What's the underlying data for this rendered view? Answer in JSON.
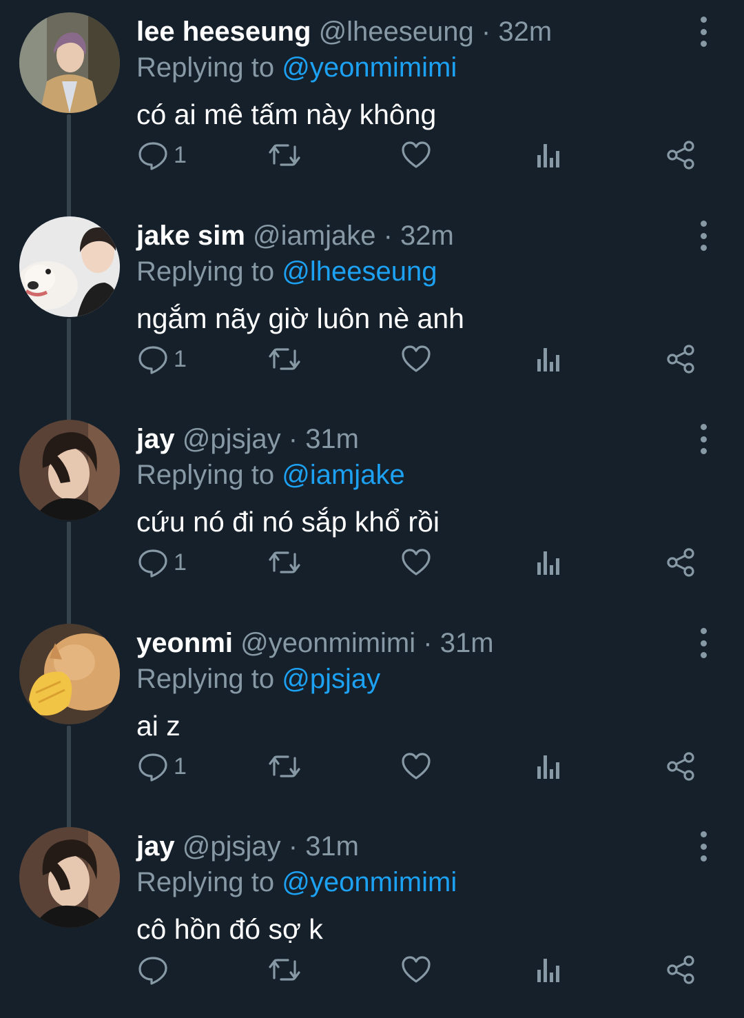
{
  "colors": {
    "background": "#15202b",
    "text": "#ffffff",
    "muted": "#8899a6",
    "mention": "#1da1f2",
    "thread_line": "#38444d"
  },
  "reply_prefix": "Replying to",
  "actions": [
    "reply-icon",
    "retweet-icon",
    "like-icon",
    "analytics-icon",
    "share-icon"
  ],
  "tweets": [
    {
      "name": "lee heeseung",
      "handle": "@lheeseung",
      "dot": "·",
      "time": "32m",
      "replying_to": "@yeonmimimi",
      "text": "có ai mê tấm này không",
      "reply_count": "1",
      "avatar": "avatar-lee-heeseung"
    },
    {
      "name": "jake sim",
      "handle": "@iamjake",
      "dot": "·",
      "time": "32m",
      "replying_to": "@lheeseung",
      "text": "ngắm nãy giờ luôn nè anh",
      "reply_count": "1",
      "avatar": "avatar-jake-sim"
    },
    {
      "name": "jay",
      "handle": "@pjsjay",
      "dot": "·",
      "time": "31m",
      "replying_to": "@iamjake",
      "text": "cứu nó đi nó sắp khổ rồi",
      "reply_count": "1",
      "avatar": "avatar-jay"
    },
    {
      "name": "yeonmi",
      "handle": "@yeonmimimi",
      "dot": "·",
      "time": "31m",
      "replying_to": "@pjsjay",
      "text": "ai z",
      "reply_count": "1",
      "avatar": "avatar-yeonmi"
    },
    {
      "name": "jay",
      "handle": "@pjsjay",
      "dot": "·",
      "time": "31m",
      "replying_to": "@yeonmimimi",
      "text": "cô hồn đó sợ k",
      "reply_count": "",
      "avatar": "avatar-jay"
    }
  ]
}
